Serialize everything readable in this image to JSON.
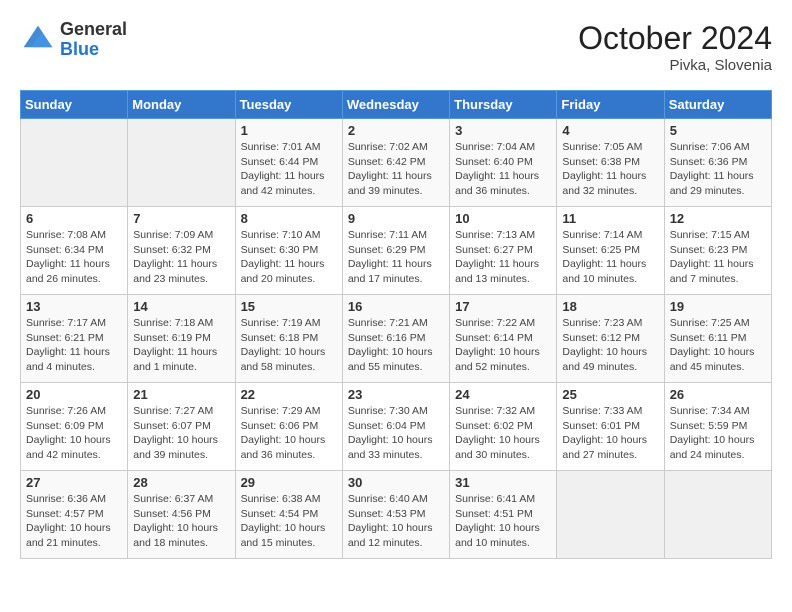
{
  "logo": {
    "general": "General",
    "blue": "Blue"
  },
  "title": "October 2024",
  "location": "Pivka, Slovenia",
  "days_header": [
    "Sunday",
    "Monday",
    "Tuesday",
    "Wednesday",
    "Thursday",
    "Friday",
    "Saturday"
  ],
  "weeks": [
    [
      {
        "num": "",
        "info": ""
      },
      {
        "num": "",
        "info": ""
      },
      {
        "num": "1",
        "info": "Sunrise: 7:01 AM\nSunset: 6:44 PM\nDaylight: 11 hours and 42 minutes."
      },
      {
        "num": "2",
        "info": "Sunrise: 7:02 AM\nSunset: 6:42 PM\nDaylight: 11 hours and 39 minutes."
      },
      {
        "num": "3",
        "info": "Sunrise: 7:04 AM\nSunset: 6:40 PM\nDaylight: 11 hours and 36 minutes."
      },
      {
        "num": "4",
        "info": "Sunrise: 7:05 AM\nSunset: 6:38 PM\nDaylight: 11 hours and 32 minutes."
      },
      {
        "num": "5",
        "info": "Sunrise: 7:06 AM\nSunset: 6:36 PM\nDaylight: 11 hours and 29 minutes."
      }
    ],
    [
      {
        "num": "6",
        "info": "Sunrise: 7:08 AM\nSunset: 6:34 PM\nDaylight: 11 hours and 26 minutes."
      },
      {
        "num": "7",
        "info": "Sunrise: 7:09 AM\nSunset: 6:32 PM\nDaylight: 11 hours and 23 minutes."
      },
      {
        "num": "8",
        "info": "Sunrise: 7:10 AM\nSunset: 6:30 PM\nDaylight: 11 hours and 20 minutes."
      },
      {
        "num": "9",
        "info": "Sunrise: 7:11 AM\nSunset: 6:29 PM\nDaylight: 11 hours and 17 minutes."
      },
      {
        "num": "10",
        "info": "Sunrise: 7:13 AM\nSunset: 6:27 PM\nDaylight: 11 hours and 13 minutes."
      },
      {
        "num": "11",
        "info": "Sunrise: 7:14 AM\nSunset: 6:25 PM\nDaylight: 11 hours and 10 minutes."
      },
      {
        "num": "12",
        "info": "Sunrise: 7:15 AM\nSunset: 6:23 PM\nDaylight: 11 hours and 7 minutes."
      }
    ],
    [
      {
        "num": "13",
        "info": "Sunrise: 7:17 AM\nSunset: 6:21 PM\nDaylight: 11 hours and 4 minutes."
      },
      {
        "num": "14",
        "info": "Sunrise: 7:18 AM\nSunset: 6:19 PM\nDaylight: 11 hours and 1 minute."
      },
      {
        "num": "15",
        "info": "Sunrise: 7:19 AM\nSunset: 6:18 PM\nDaylight: 10 hours and 58 minutes."
      },
      {
        "num": "16",
        "info": "Sunrise: 7:21 AM\nSunset: 6:16 PM\nDaylight: 10 hours and 55 minutes."
      },
      {
        "num": "17",
        "info": "Sunrise: 7:22 AM\nSunset: 6:14 PM\nDaylight: 10 hours and 52 minutes."
      },
      {
        "num": "18",
        "info": "Sunrise: 7:23 AM\nSunset: 6:12 PM\nDaylight: 10 hours and 49 minutes."
      },
      {
        "num": "19",
        "info": "Sunrise: 7:25 AM\nSunset: 6:11 PM\nDaylight: 10 hours and 45 minutes."
      }
    ],
    [
      {
        "num": "20",
        "info": "Sunrise: 7:26 AM\nSunset: 6:09 PM\nDaylight: 10 hours and 42 minutes."
      },
      {
        "num": "21",
        "info": "Sunrise: 7:27 AM\nSunset: 6:07 PM\nDaylight: 10 hours and 39 minutes."
      },
      {
        "num": "22",
        "info": "Sunrise: 7:29 AM\nSunset: 6:06 PM\nDaylight: 10 hours and 36 minutes."
      },
      {
        "num": "23",
        "info": "Sunrise: 7:30 AM\nSunset: 6:04 PM\nDaylight: 10 hours and 33 minutes."
      },
      {
        "num": "24",
        "info": "Sunrise: 7:32 AM\nSunset: 6:02 PM\nDaylight: 10 hours and 30 minutes."
      },
      {
        "num": "25",
        "info": "Sunrise: 7:33 AM\nSunset: 6:01 PM\nDaylight: 10 hours and 27 minutes."
      },
      {
        "num": "26",
        "info": "Sunrise: 7:34 AM\nSunset: 5:59 PM\nDaylight: 10 hours and 24 minutes."
      }
    ],
    [
      {
        "num": "27",
        "info": "Sunrise: 6:36 AM\nSunset: 4:57 PM\nDaylight: 10 hours and 21 minutes."
      },
      {
        "num": "28",
        "info": "Sunrise: 6:37 AM\nSunset: 4:56 PM\nDaylight: 10 hours and 18 minutes."
      },
      {
        "num": "29",
        "info": "Sunrise: 6:38 AM\nSunset: 4:54 PM\nDaylight: 10 hours and 15 minutes."
      },
      {
        "num": "30",
        "info": "Sunrise: 6:40 AM\nSunset: 4:53 PM\nDaylight: 10 hours and 12 minutes."
      },
      {
        "num": "31",
        "info": "Sunrise: 6:41 AM\nSunset: 4:51 PM\nDaylight: 10 hours and 10 minutes."
      },
      {
        "num": "",
        "info": ""
      },
      {
        "num": "",
        "info": ""
      }
    ]
  ]
}
